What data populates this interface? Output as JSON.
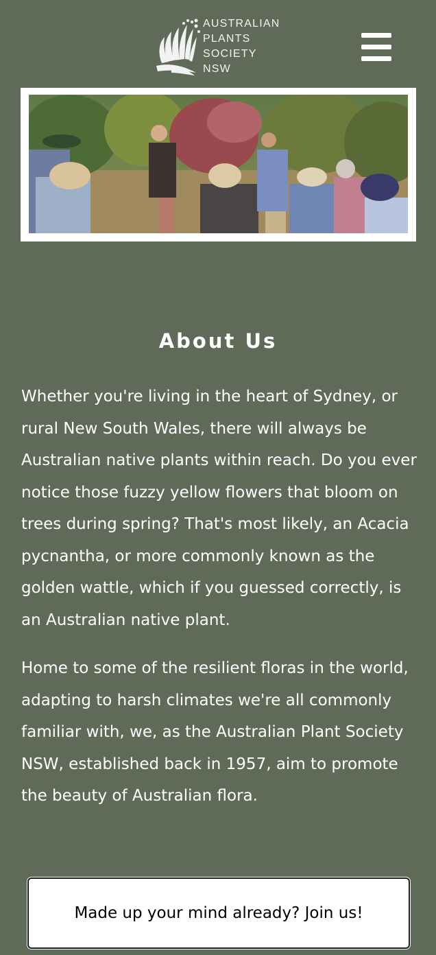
{
  "header": {
    "logo_lines": [
      "AUSTRALIAN",
      "PLANTS",
      "SOCIETY",
      "NSW"
    ],
    "menu_icon": "hamburger-menu-icon"
  },
  "hero": {
    "image_subject": "Group of people in sun hats on a garden walk among native plants"
  },
  "about": {
    "title": "About Us",
    "paragraph1": "Whether you're living in the heart of Sydney, or rural New South Wales, there will always be Australian native plants within reach. Do you ever notice those fuzzy yellow flowers that bloom on trees during spring? That's most likely, an Acacia pycnantha, or more commonly known as the golden wattle, which if you guessed correctly, is an Australian native plant.",
    "paragraph2": "Home to some of the resilient floras in the world, adapting to harsh climates we're all commonly familiar with, we, as the Australian Plant Society NSW, established back in 1957, aim to promote the beauty of Australian flora."
  },
  "cta": {
    "join_label": "Made up your mind already? Join us!"
  },
  "colors": {
    "background": "#5f6a59",
    "text": "#ffffff",
    "button_bg": "#ffffff",
    "button_text": "#000000"
  }
}
